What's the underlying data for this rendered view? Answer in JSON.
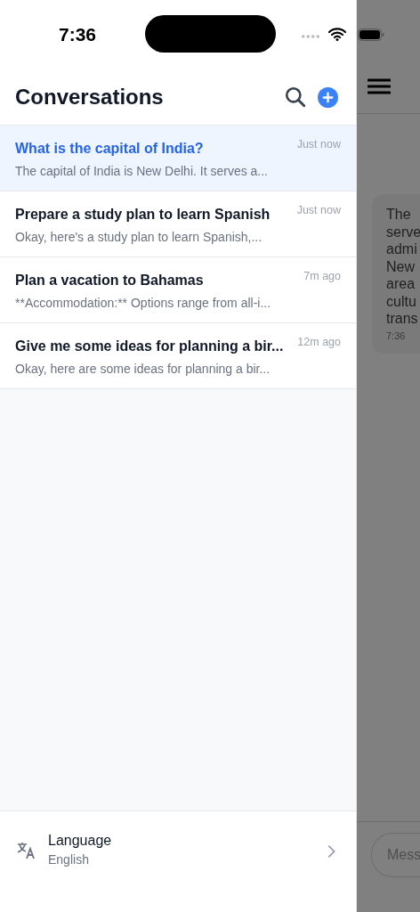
{
  "status_bar": {
    "time": "7:36"
  },
  "drawer": {
    "title": "Conversations",
    "conversations": [
      {
        "title": "What is the capital of India?",
        "preview": "The capital of India is New Delhi. It serves a...",
        "time": "Just now",
        "selected": true
      },
      {
        "title": "Prepare a study plan to learn Spanish",
        "preview": "Okay, here's a study plan to learn Spanish,...",
        "time": "Just now",
        "selected": false
      },
      {
        "title": "Plan a vacation to Bahamas",
        "preview": "**Accommodation:** Options range from all-i...",
        "time": "7m ago",
        "selected": false
      },
      {
        "title": "Give me some ideas for planning a bir...",
        "preview": "Okay, here are some ideas for planning a bir...",
        "time": "12m ago",
        "selected": false
      }
    ],
    "footer": {
      "label": "Language",
      "value": "English"
    }
  },
  "chat": {
    "message_lines": [
      "The",
      "serve",
      "admi",
      "New",
      "area",
      "cultu",
      "trans"
    ],
    "message_time": "7:36",
    "input_placeholder": "Mess"
  }
}
